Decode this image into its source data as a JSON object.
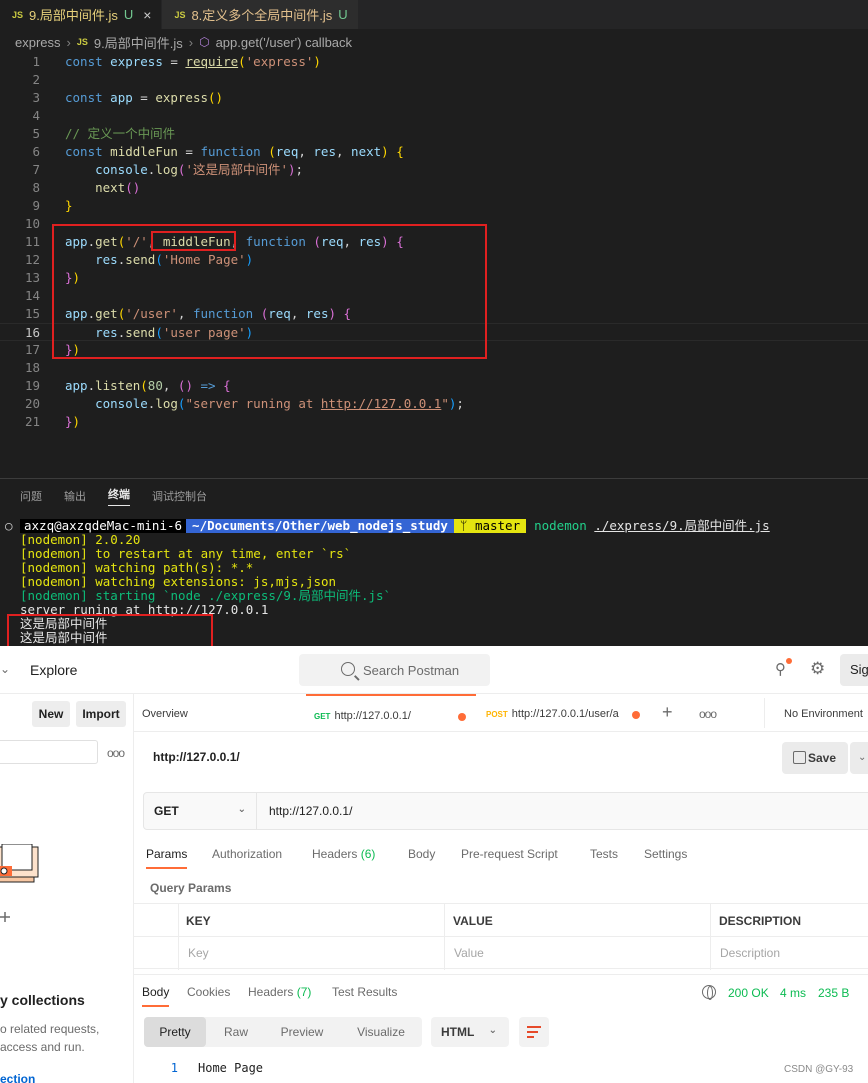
{
  "editor": {
    "tabs": [
      {
        "icon": "JS",
        "label": "9.局部中间件.js",
        "status": "U",
        "close": "×"
      },
      {
        "icon": "JS",
        "label": "8.定义多个全局中间件.js",
        "status": "U"
      }
    ],
    "breadcrumb": {
      "folder": "express",
      "file_icon": "JS",
      "file": "9.局部中间件.js",
      "symbol": "app.get('/user') callback"
    },
    "line_numbers": [
      "1",
      "2",
      "3",
      "4",
      "5",
      "6",
      "7",
      "8",
      "9",
      "10",
      "11",
      "12",
      "13",
      "14",
      "15",
      "16",
      "17",
      "18",
      "19",
      "20",
      "21"
    ],
    "code": {
      "l1_const": "const",
      "l1_express": "express",
      "l1_eq": " = ",
      "l1_require": "require",
      "l1_str": "'express'",
      "l3_const": "const",
      "l3_app": "app",
      "l3_eq": " = ",
      "l3_express": "express",
      "l5_comment": "// 定义一个中间件",
      "l6_const": "const",
      "l6_name": "middleFun",
      "l6_eq": " = ",
      "l6_function": "function",
      "l6_req": "req",
      "l6_res": "res",
      "l6_next": "next",
      "l7_console": "console",
      "l7_log": "log",
      "l7_str": "'这是局部中间件'",
      "l8_next": "next",
      "l11_app": "app",
      "l11_get": "get",
      "l11_str": "'/'",
      "l11_mw": "middleFun",
      "l11_function": "function",
      "l11_req": "req",
      "l11_res": "res",
      "l12_res": "res",
      "l12_send": "send",
      "l12_str": "'Home Page'",
      "l15_app": "app",
      "l15_get": "get",
      "l15_str": "'/user'",
      "l15_function": "function",
      "l15_req": "req",
      "l15_res": "res",
      "l16_res": "res",
      "l16_send": "send",
      "l16_str": "'user page'",
      "l19_app": "app",
      "l19_listen": "listen",
      "l19_port": "80",
      "l19_arrow": "=>",
      "l20_console": "console",
      "l20_log": "log",
      "l20_str_a": "\"server runing at ",
      "l20_url": "http://127.0.0.1",
      "l20_str_b": "\""
    }
  },
  "terminal": {
    "panel_tabs": [
      "问题",
      "输出",
      "终端",
      "调试控制台"
    ],
    "active_tab": "终端",
    "prompt_dot": "○",
    "user_host": "axzq@axzqdeMac-mini-6",
    "path": "~/Documents/Other/web_nodejs_study",
    "branch": "ᛘ master",
    "command": "nodemon",
    "command_arg": "./express/9.局部中间件.js",
    "lines": [
      "[nodemon] 2.0.20",
      "[nodemon] to restart at any time, enter `rs`",
      "[nodemon] watching path(s): *.*",
      "[nodemon] watching extensions: js,mjs,json",
      "[nodemon] starting `node ./express/9.局部中间件.js`",
      "server runing at http://127.0.0.1",
      "这是局部中间件",
      "这是局部中间件"
    ]
  },
  "postman": {
    "header": {
      "chevron": "⌄",
      "title": "Explore",
      "search_placeholder": "Search Postman",
      "sign_in": "Sig"
    },
    "sidebar": {
      "new_label": "New",
      "import_label": "Import",
      "more": "ooo",
      "empty_title": "y collections",
      "empty_desc_1": "o related requests,",
      "empty_desc_2": " access and run.",
      "link": "ection"
    },
    "tabs": {
      "overview": "Overview",
      "tab1_method": "GET",
      "tab1_url": "http://127.0.0.1/",
      "tab2_method": "POST",
      "tab2_url": "http://127.0.0.1/user/a",
      "plus": "+",
      "more": "ooo",
      "environment": "No Environment"
    },
    "request": {
      "title": "http://127.0.0.1/",
      "save": "Save",
      "method": "GET",
      "url": "http://127.0.0.1/"
    },
    "subtabs": {
      "params": "Params",
      "authorization": "Authorization",
      "headers": "Headers",
      "headers_count": "(6)",
      "body": "Body",
      "prerequest": "Pre-request Script",
      "tests": "Tests",
      "settings": "Settings"
    },
    "query_params": {
      "title": "Query Params",
      "col_key": "KEY",
      "col_value": "VALUE",
      "col_desc": "DESCRIPTION",
      "ph_key": "Key",
      "ph_value": "Value",
      "ph_desc": "Description"
    },
    "response": {
      "tab_body": "Body",
      "tab_cookies": "Cookies",
      "tab_headers": "Headers",
      "headers_count": "(7)",
      "tab_tests": "Test Results",
      "status": "200 OK",
      "time": "4 ms",
      "size": "235 B",
      "fmt_pretty": "Pretty",
      "fmt_raw": "Raw",
      "fmt_preview": "Preview",
      "fmt_visualize": "Visualize",
      "lang": "HTML",
      "line_no": "1",
      "body_text": "Home Page"
    }
  },
  "watermark": "CSDN @GY-93",
  "colors": {
    "highlight_box": "#e02020",
    "postman_accent": "#ff6c37",
    "status_ok": "#0cbb52"
  }
}
